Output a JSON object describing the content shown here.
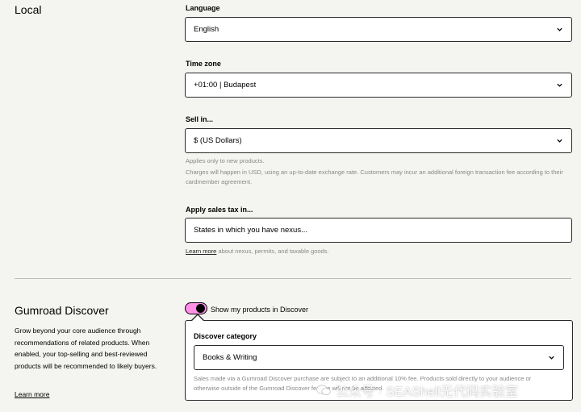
{
  "local": {
    "title": "Local",
    "language": {
      "label": "Language",
      "value": "English"
    },
    "timezone": {
      "label": "Time zone",
      "value": "+01:00 | Budapest"
    },
    "currency": {
      "label": "Sell in...",
      "value": "$ (US Dollars)",
      "help1": "Applies only to new products.",
      "help2": "Charges will happen in USD, using an up-to-date exchange rate. Customers may incur an additional foreign transaction fee according to their cardmember agreement."
    },
    "sales_tax": {
      "label": "Apply sales tax in...",
      "placeholder": "States in which you have nexus...",
      "learn_more": "Learn more",
      "help": "about nexus, permits, and taxable goods."
    }
  },
  "discover": {
    "title": "Gumroad Discover",
    "description": "Grow beyond your core audience through recommendations of related products. When enabled, your top-selling and best-reviewed products will be recommended to likely buyers.",
    "learn_more": "Learn more",
    "toggle_label": "Show my products in Discover",
    "toggle_on": true,
    "category_label": "Discover category",
    "category_value": "Books & Writing",
    "note": "Sales made via a Gumroad Discover purchase are subject to an additional 10% fee. Products sold directly to your audience or otherwise outside of the Gumroad Discover feature will not be affected."
  },
  "watermark": "公众号 · SEAShell无代码实验室",
  "colors": {
    "toggle_accent": "#ff90e8",
    "background": "#f4f4f0"
  },
  "icons": [
    "chevron-down-icon",
    "wechat-icon"
  ]
}
